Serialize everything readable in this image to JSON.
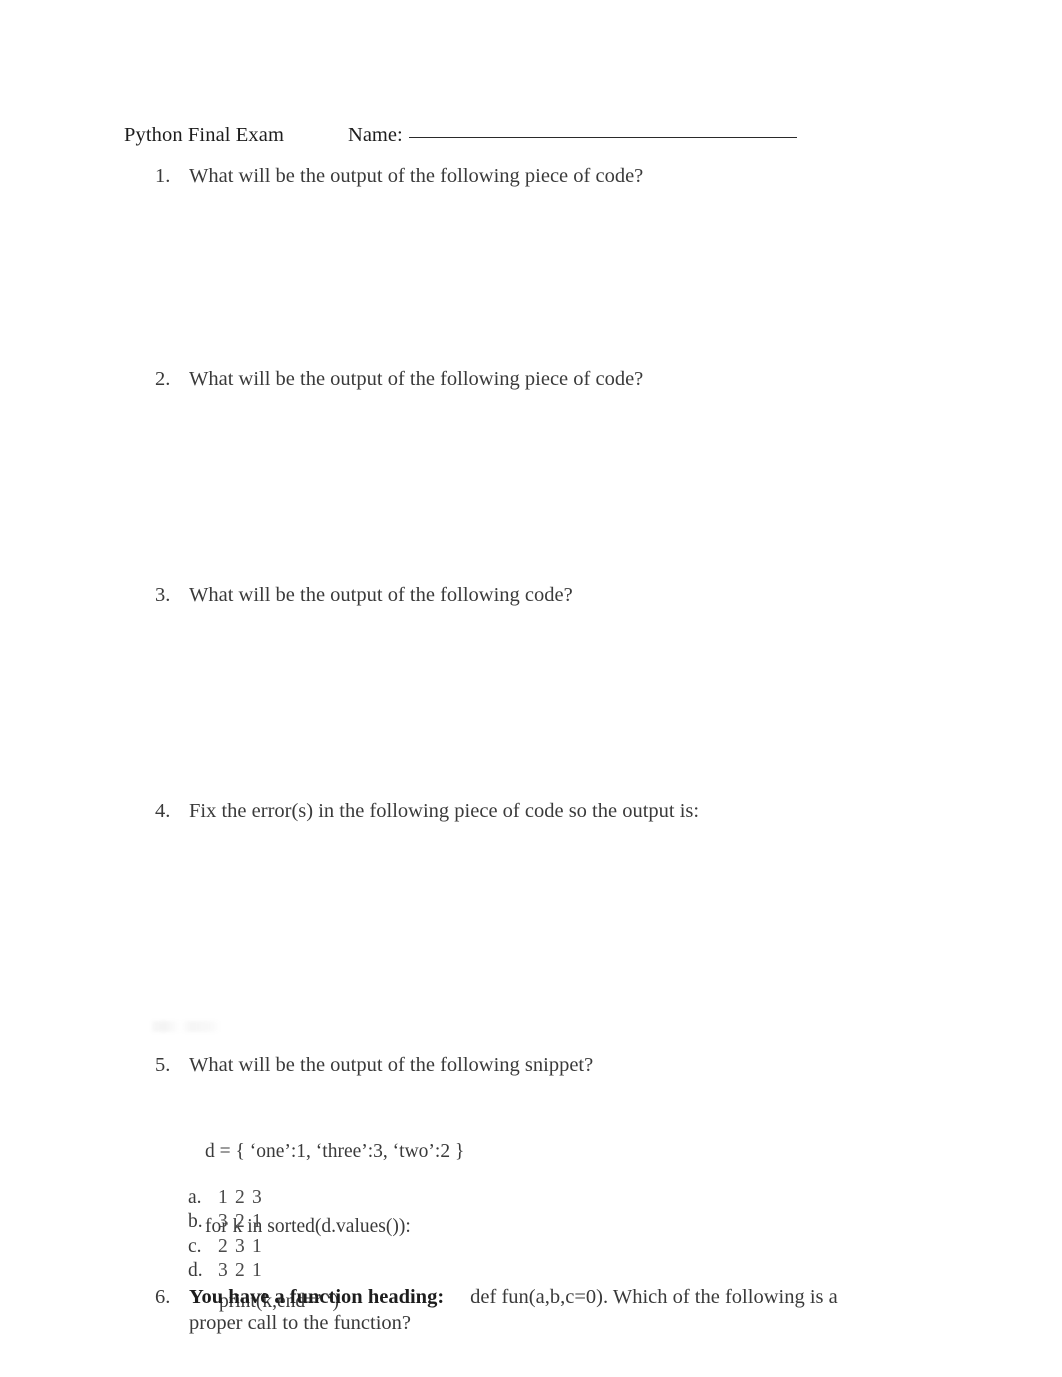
{
  "document": {
    "title": "Python Final Exam",
    "name_label": "Name:",
    "name_value": ""
  },
  "questions": [
    {
      "number": "1.",
      "text": "What will be the output of the following piece of code?"
    },
    {
      "number": "2.",
      "text": "What will be the output of the following piece of code?"
    },
    {
      "number": "3.",
      "text": "What will be the output of the following code?"
    },
    {
      "number": "4.",
      "text": "Fix the error(s) in the following piece of code so the output is:"
    },
    {
      "number": "5.",
      "text": "What will be the output of the following snippet?",
      "code": {
        "line1": "d = { ‘one’:1, ‘three’:3, ‘two’:2 }",
        "line2": "for k in sorted(d.values()):",
        "line3": "print(k,end=’ ‘)"
      },
      "choices": [
        {
          "letter": "a.",
          "text": "1 2 3"
        },
        {
          "letter": "b.",
          "text": "3 2 1"
        },
        {
          "letter": "c.",
          "text": "2 3 1"
        },
        {
          "letter": "d.",
          "text": "3 2 1"
        }
      ]
    },
    {
      "number": "6.",
      "lead": "You have a function heading:",
      "text": "def fun(a,b,c=0). Which of the following is a proper call to the function?"
    }
  ],
  "colors": {
    "page_background": "#ffffff",
    "body_text": "#3a3a3a",
    "heading_text": "#1d1d1d",
    "rule": "#2a2a2a"
  }
}
